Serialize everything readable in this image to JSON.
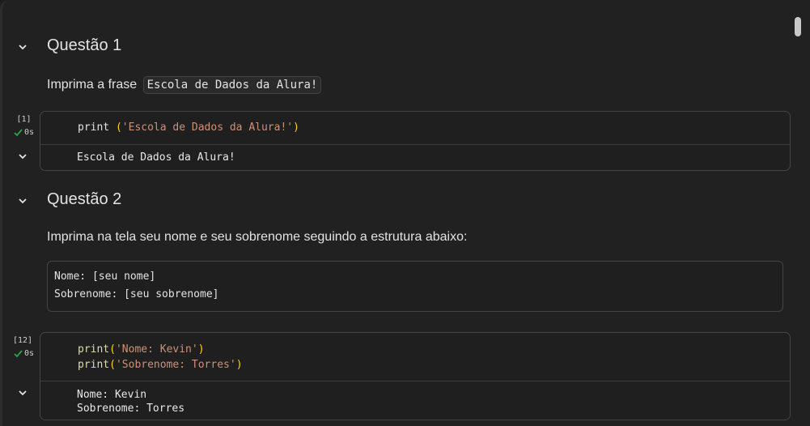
{
  "sections": [
    {
      "heading": "Questão 1",
      "instruction_text": "Imprima a frase",
      "instruction_code": "Escola de Dados da Alura!",
      "cell": {
        "execution_count": "[1]",
        "exec_time": "0s",
        "code": {
          "fn": "print",
          "sep": " ",
          "open": "(",
          "str": "'Escola de Dados da Alura!'",
          "close": ")"
        },
        "output": [
          "Escola de Dados da Alura!"
        ]
      }
    },
    {
      "heading": "Questão 2",
      "instruction_text": "Imprima na tela seu nome e seu sobrenome seguindo a estrutura abaixo:",
      "pre_block": [
        "Nome: [seu nome]",
        "Sobrenome: [seu sobrenome]"
      ],
      "cell": {
        "execution_count": "[12]",
        "exec_time": "0s",
        "code_lines": [
          {
            "fn": "print",
            "open": "(",
            "str": "'Nome: Kevin'",
            "close": ")"
          },
          {
            "fn": "print",
            "open": "(",
            "str": "'Sobrenome: Torres'",
            "close": ")"
          }
        ],
        "output": [
          "Nome: Kevin",
          "Sobrenome: Torres"
        ]
      }
    }
  ],
  "icons": {
    "collapse": "chevron-down-icon",
    "success": "check-icon"
  },
  "colors": {
    "background": "#212121",
    "success_check": "#2ea043",
    "string": "#ce9178",
    "paren": "#ffd700",
    "function": "#dcdcaa"
  }
}
